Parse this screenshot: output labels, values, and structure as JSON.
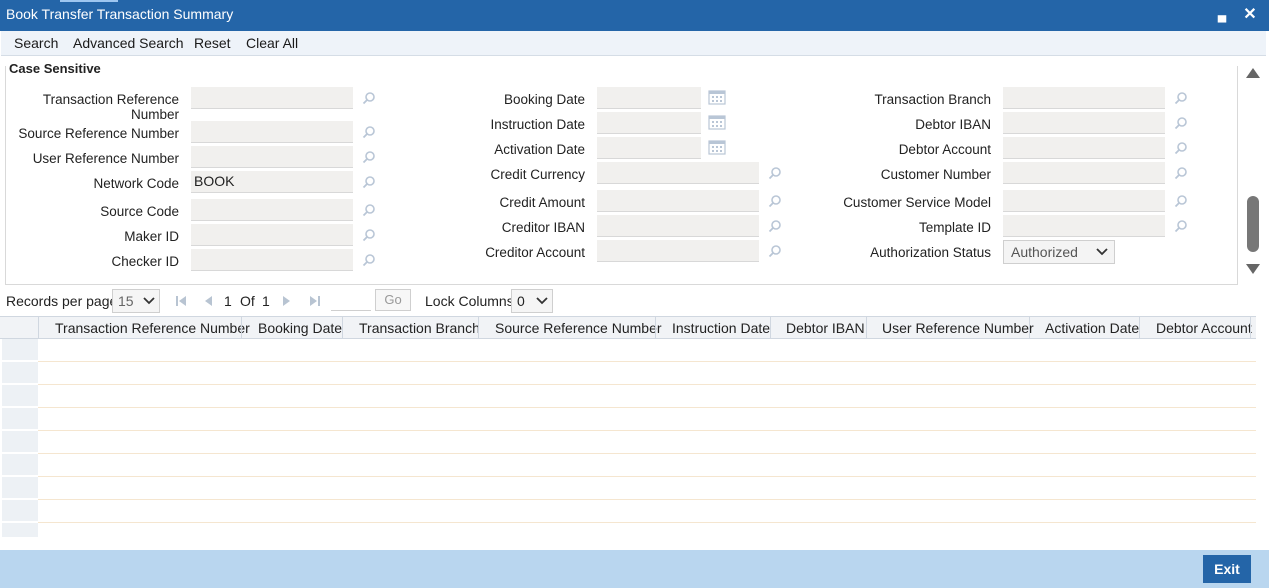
{
  "window": {
    "title": "Book Transfer Transaction Summary",
    "minimize_glyph": "▄",
    "close_glyph": "✕"
  },
  "toolbar": {
    "search": "Search",
    "advanced_search": "Advanced Search",
    "reset": "Reset",
    "clear_all": "Clear All"
  },
  "criteria": {
    "section_label": "Case Sensitive",
    "col1": [
      {
        "label": "Transaction Reference Number",
        "value": ""
      },
      {
        "label": "Source Reference Number",
        "value": ""
      },
      {
        "label": "User Reference Number",
        "value": ""
      },
      {
        "label": "Network Code",
        "value": "BOOK"
      },
      {
        "label": "Source Code",
        "value": ""
      },
      {
        "label": "Maker ID",
        "value": ""
      },
      {
        "label": "Checker ID",
        "value": ""
      }
    ],
    "col2": [
      {
        "label": "Booking Date",
        "value": ""
      },
      {
        "label": "Instruction Date",
        "value": ""
      },
      {
        "label": "Activation Date",
        "value": ""
      },
      {
        "label": "Credit Currency",
        "value": ""
      },
      {
        "label": "Credit Amount",
        "value": ""
      },
      {
        "label": "Creditor IBAN",
        "value": ""
      },
      {
        "label": "Creditor Account",
        "value": ""
      }
    ],
    "col3": [
      {
        "label": "Transaction Branch",
        "value": ""
      },
      {
        "label": "Debtor IBAN",
        "value": ""
      },
      {
        "label": "Debtor Account",
        "value": ""
      },
      {
        "label": "Customer Number",
        "value": ""
      },
      {
        "label": "Customer Service Model",
        "value": ""
      },
      {
        "label": "Template ID",
        "value": ""
      },
      {
        "label": "Authorization Status",
        "value": "Authorized"
      }
    ]
  },
  "pager": {
    "records_label": "Records per page",
    "records_value": "15",
    "current_page": "1",
    "of_label": "Of",
    "total_pages": "1",
    "go_label": "Go",
    "lock_label": "Lock Columns",
    "lock_value": "0"
  },
  "grid": {
    "columns": [
      "Transaction Reference Number",
      "Booking Date",
      "Transaction Branch",
      "Source Reference Number",
      "Instruction Date",
      "Debtor IBAN",
      "User Reference Number",
      "Activation Date",
      "Debtor Account"
    ]
  },
  "footer": {
    "exit": "Exit"
  },
  "colors": {
    "titlebar": "#2465a8",
    "footer": "#b9d6ef",
    "field_bg": "#f1f0ee"
  }
}
